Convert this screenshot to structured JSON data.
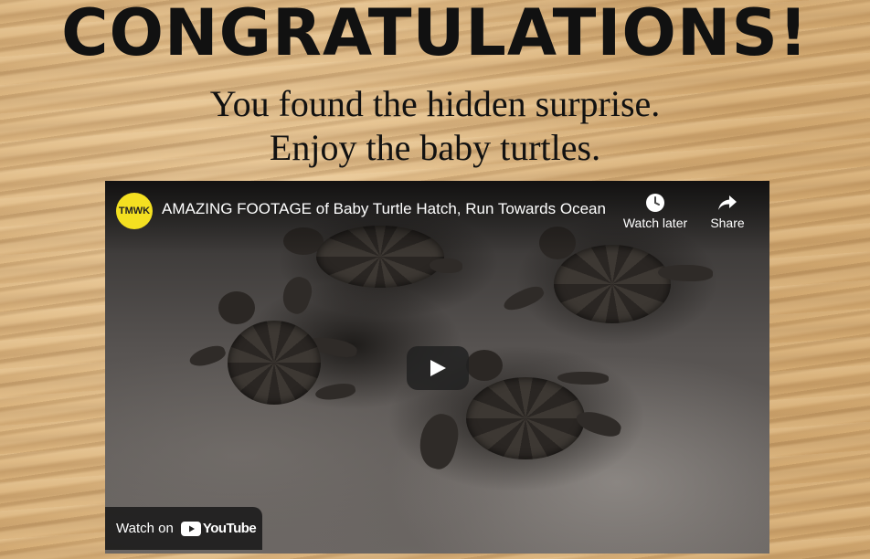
{
  "page": {
    "heading": "CONGRATULATIONS!",
    "subtitle_line1": "You found the hidden surprise.",
    "subtitle_line2": "Enjoy the baby turtles."
  },
  "video": {
    "channel_logo_text": "TMWK",
    "title": "AMAZING FOOTAGE of Baby Turtle Hatch, Run Towards Ocean",
    "watch_later_label": "Watch later",
    "share_label": "Share",
    "watch_on_label": "Watch on",
    "platform_name": "YouTube",
    "colors": {
      "channel_logo_bg": "#f4e021",
      "youtube_red": "#ff0000"
    }
  }
}
